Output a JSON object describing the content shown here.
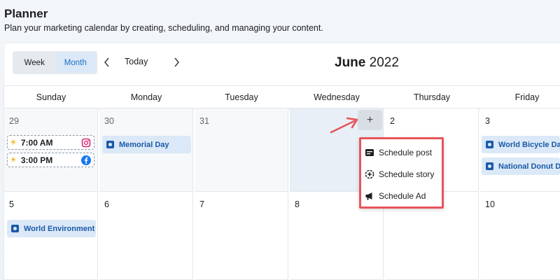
{
  "page": {
    "title": "Planner",
    "subtitle": "Plan your marketing calendar by creating, scheduling, and managing your content."
  },
  "toolbar": {
    "view_week": "Week",
    "view_month": "Month",
    "today": "Today",
    "month_name": "June",
    "year": "2022",
    "prev_icon": "chevron-left-icon",
    "next_icon": "chevron-right-icon"
  },
  "weekdays": [
    "Sunday",
    "Monday",
    "Tuesday",
    "Wednesday",
    "Thursday",
    "Friday"
  ],
  "week1": {
    "dates": [
      "29",
      "30",
      "31",
      "",
      "2",
      "3"
    ],
    "posts": [
      {
        "time": "7:00 AM",
        "network": "instagram"
      },
      {
        "time": "3:00 PM",
        "network": "facebook"
      }
    ],
    "events": {
      "monday": "Memorial Day",
      "friday_1": "World Bicycle Day",
      "friday_2": "National Donut Day"
    }
  },
  "week2": {
    "dates": [
      "5",
      "6",
      "7",
      "8",
      "",
      "10"
    ],
    "events": {
      "sunday": "World Environment Day"
    }
  },
  "add_button": "+",
  "dropdown": {
    "items": [
      {
        "label": "Schedule post",
        "icon": "post-icon"
      },
      {
        "label": "Schedule story",
        "icon": "story-icon"
      },
      {
        "label": "Schedule Ad",
        "icon": "megaphone-icon"
      }
    ]
  },
  "colors": {
    "accent": "#1a6fc4",
    "event_bg": "#dbe8f7",
    "highlight_border": "#e8545c",
    "instagram": "#d62976",
    "facebook": "#1877f2"
  }
}
